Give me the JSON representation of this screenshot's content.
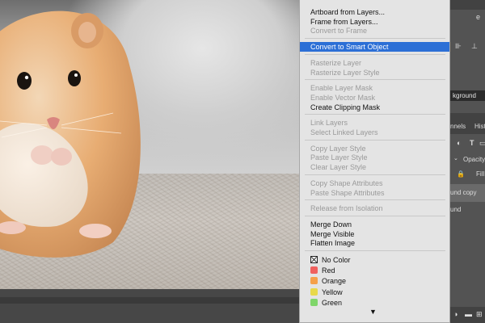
{
  "canvas": {
    "image_subject": "hamster-photo"
  },
  "menu": {
    "groups": [
      [
        {
          "label": "Artboard from Layers...",
          "enabled": true
        },
        {
          "label": "Frame from Layers...",
          "enabled": true
        },
        {
          "label": "Convert to Frame",
          "enabled": false
        }
      ],
      [
        {
          "label": "Convert to Smart Object",
          "enabled": true,
          "highlighted": true
        }
      ],
      [
        {
          "label": "Rasterize Layer",
          "enabled": false
        },
        {
          "label": "Rasterize Layer Style",
          "enabled": false
        }
      ],
      [
        {
          "label": "Enable Layer Mask",
          "enabled": false
        },
        {
          "label": "Enable Vector Mask",
          "enabled": false
        },
        {
          "label": "Create Clipping Mask",
          "enabled": true
        }
      ],
      [
        {
          "label": "Link Layers",
          "enabled": false
        },
        {
          "label": "Select Linked Layers",
          "enabled": false
        }
      ],
      [
        {
          "label": "Copy Layer Style",
          "enabled": false
        },
        {
          "label": "Paste Layer Style",
          "enabled": false
        },
        {
          "label": "Clear Layer Style",
          "enabled": false
        }
      ],
      [
        {
          "label": "Copy Shape Attributes",
          "enabled": false
        },
        {
          "label": "Paste Shape Attributes",
          "enabled": false
        }
      ],
      [
        {
          "label": "Release from Isolation",
          "enabled": false
        }
      ],
      [
        {
          "label": "Merge Down",
          "enabled": true
        },
        {
          "label": "Merge Visible",
          "enabled": true
        },
        {
          "label": "Flatten Image",
          "enabled": true
        }
      ]
    ],
    "colors": [
      {
        "label": "No Color",
        "color": "none"
      },
      {
        "label": "Red",
        "color": "#f0605e"
      },
      {
        "label": "Orange",
        "color": "#f5a04a"
      },
      {
        "label": "Yellow",
        "color": "#e8d94a"
      },
      {
        "label": "Green",
        "color": "#7fd66a"
      }
    ],
    "scroll_down_glyph": "▼"
  },
  "panel": {
    "top_glyph": "e",
    "layer_field": "kground",
    "tab_channels": "nnels",
    "tab_history": "Hist",
    "type_glyph": "T",
    "opacity_label": "Opacity:",
    "fill_label": "Fill:",
    "layer1_name": "und copy",
    "layer2_name": "und",
    "colors": {
      "accent": "#2c6fd6",
      "menu_bg": "#e4e4e4",
      "panel_bg": "#535353"
    }
  }
}
